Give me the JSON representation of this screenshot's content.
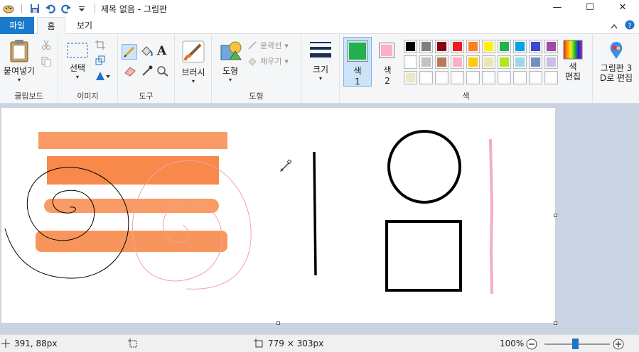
{
  "titlebar": {
    "title": "제목 없음 - 그림판",
    "buttons": {
      "minimize": "—",
      "maximize": "☐",
      "close": "✕"
    }
  },
  "tabs": {
    "file": "파일",
    "home": "홈",
    "view": "보기"
  },
  "ribbon": {
    "clipboard": {
      "label": "클립보드",
      "paste": "붙여넣기"
    },
    "image": {
      "label": "이미지",
      "select": "선택"
    },
    "tools": {
      "label": "도구"
    },
    "brushes": {
      "label": "브러시"
    },
    "shapes": {
      "label": "도형",
      "shapes_btn": "도형",
      "outline": "윤곽선",
      "fill": "채우기"
    },
    "size": {
      "label": "크기"
    },
    "colors": {
      "label": "색",
      "color1": "색\n1",
      "color1_a": "색",
      "color1_b": "1",
      "color2_a": "색",
      "color2_b": "2",
      "edit_a": "색",
      "edit_b": "편집",
      "paint3d_a": "그림판 3",
      "paint3d_b": "D로 편집",
      "color1_value": "#22b14c",
      "color2_value": "#ffaec9",
      "palette_row1": [
        "#000000",
        "#7f7f7f",
        "#880015",
        "#ed1c24",
        "#ff7f27",
        "#fff200",
        "#22b14c",
        "#00a2e8",
        "#3f48cc",
        "#a349a4"
      ],
      "palette_row2": [
        "#ffffff",
        "#c3c3c3",
        "#b97a57",
        "#ffaec9",
        "#ffc90e",
        "#efe4b0",
        "#b5e61d",
        "#99d9ea",
        "#7092be",
        "#c8bfe7"
      ],
      "palette_row3": [
        "#ece9c4",
        "#ffffff",
        "#ffffff",
        "#ffffff",
        "#ffffff",
        "#ffffff",
        "#ffffff",
        "#ffffff",
        "#ffffff",
        "#ffffff"
      ]
    }
  },
  "status": {
    "cursor_pos": "391, 88px",
    "canvas_size": "779 × 303px",
    "zoom": "100%",
    "zoom_percent": 100
  }
}
